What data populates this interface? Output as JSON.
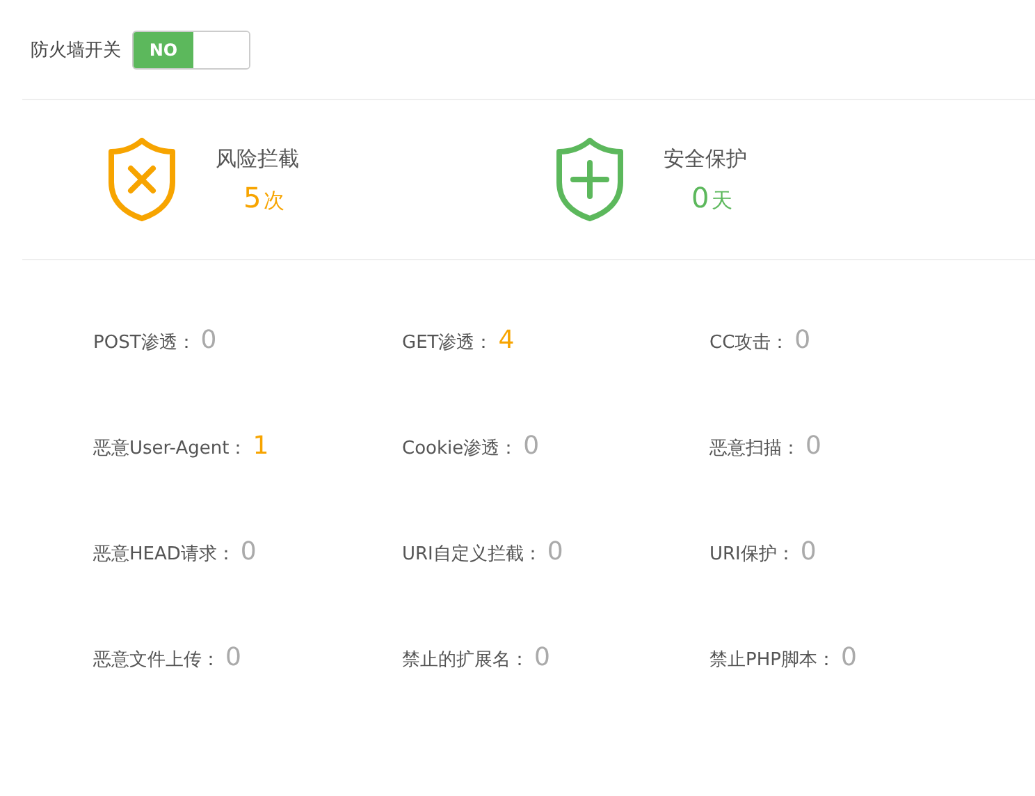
{
  "firewall": {
    "label": "防火墙开关",
    "toggle": {
      "text": "NO",
      "on": true
    }
  },
  "summary": [
    {
      "kind": "blocked",
      "title": "风险拦截",
      "value": "5",
      "unit": "次"
    },
    {
      "kind": "protected",
      "title": "安全保护",
      "value": "0",
      "unit": "天"
    }
  ],
  "stats": [
    {
      "label": "POST渗透：",
      "count": "0",
      "alert": false
    },
    {
      "label": "GET渗透：",
      "count": "4",
      "alert": true
    },
    {
      "label": "CC攻击：",
      "count": "0",
      "alert": false
    },
    {
      "label": "恶意User-Agent：",
      "count": "1",
      "alert": true
    },
    {
      "label": "Cookie渗透：",
      "count": "0",
      "alert": false
    },
    {
      "label": "恶意扫描：",
      "count": "0",
      "alert": false
    },
    {
      "label": "恶意HEAD请求：",
      "count": "0",
      "alert": false
    },
    {
      "label": "URI自定义拦截：",
      "count": "0",
      "alert": false
    },
    {
      "label": "URI保护：",
      "count": "0",
      "alert": false
    },
    {
      "label": "恶意文件上传：",
      "count": "0",
      "alert": false
    },
    {
      "label": "禁止的扩展名：",
      "count": "0",
      "alert": false
    },
    {
      "label": "禁止PHP脚本：",
      "count": "0",
      "alert": false
    }
  ]
}
